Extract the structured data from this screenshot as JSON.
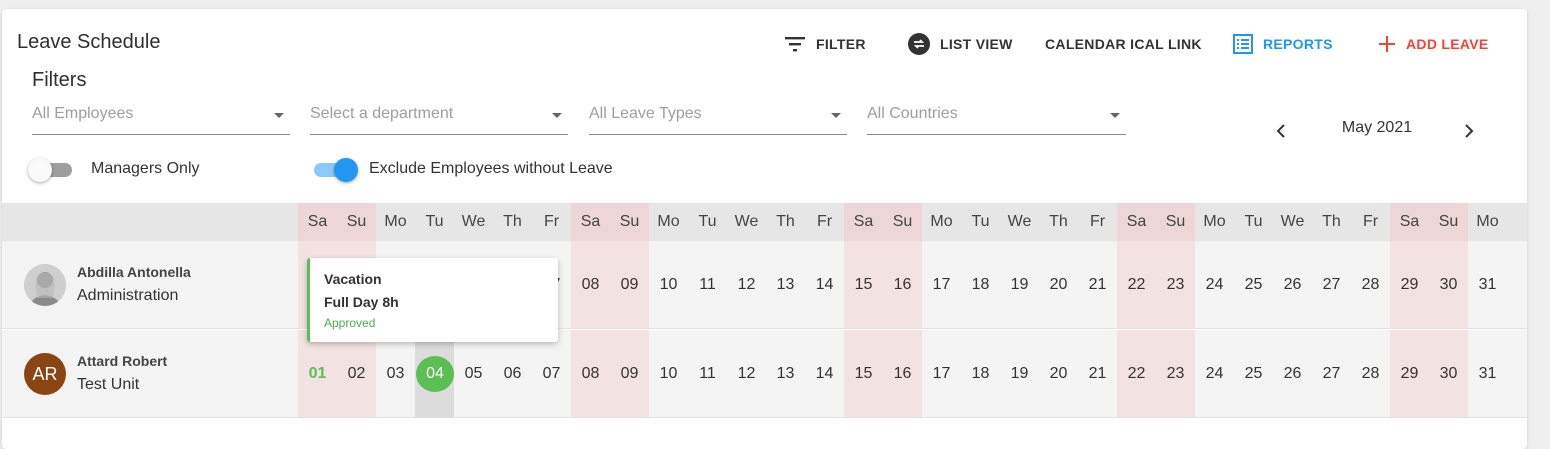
{
  "header": {
    "title": "Leave Schedule",
    "actions": {
      "filter": "FILTER",
      "list_view": "LIST VIEW",
      "ical": "CALENDAR ICAL LINK",
      "reports": "REPORTS",
      "add_leave": "ADD LEAVE"
    },
    "colors": {
      "reports": "#2196f3",
      "add_leave": "#f44336",
      "default": "#333333"
    }
  },
  "filters": {
    "title": "Filters",
    "employees_placeholder": "All Employees",
    "department_placeholder": "Select a department",
    "leave_types_placeholder": "All Leave Types",
    "countries_placeholder": "All Countries",
    "month": "May 2021",
    "managers_only": {
      "label": "Managers Only",
      "on": false
    },
    "exclude_without_leave": {
      "label": "Exclude Employees without Leave",
      "on": true
    }
  },
  "calendar": {
    "day_names": [
      "Sa",
      "Su",
      "Mo",
      "Tu",
      "We",
      "Th",
      "Fr",
      "Sa",
      "Su",
      "Mo",
      "Tu",
      "We",
      "Th",
      "Fr",
      "Sa",
      "Su",
      "Mo",
      "Tu",
      "We",
      "Th",
      "Fr",
      "Sa",
      "Su",
      "Mo",
      "Tu",
      "We",
      "Th",
      "Fr",
      "Sa",
      "Su",
      "Mo"
    ],
    "days": [
      "01",
      "02",
      "03",
      "04",
      "05",
      "06",
      "07",
      "08",
      "09",
      "10",
      "11",
      "12",
      "13",
      "14",
      "15",
      "16",
      "17",
      "18",
      "19",
      "20",
      "21",
      "22",
      "23",
      "24",
      "25",
      "26",
      "27",
      "28",
      "29",
      "30",
      "31"
    ],
    "weekend_color": "#f3e2e2",
    "leave_color": "#5cbf53"
  },
  "employees": [
    {
      "name": "Abdilla Antonella",
      "department": "Administration",
      "avatar": "photo",
      "leave_days": []
    },
    {
      "name": "Attard Robert",
      "department": "Test Unit",
      "initials": "AR",
      "avatar_color": "#8b4513",
      "leave_days": [
        "04"
      ],
      "highlight_day": "01"
    }
  ],
  "tooltip": {
    "type": "Vacation",
    "duration": "Full Day 8h",
    "status": "Approved"
  }
}
